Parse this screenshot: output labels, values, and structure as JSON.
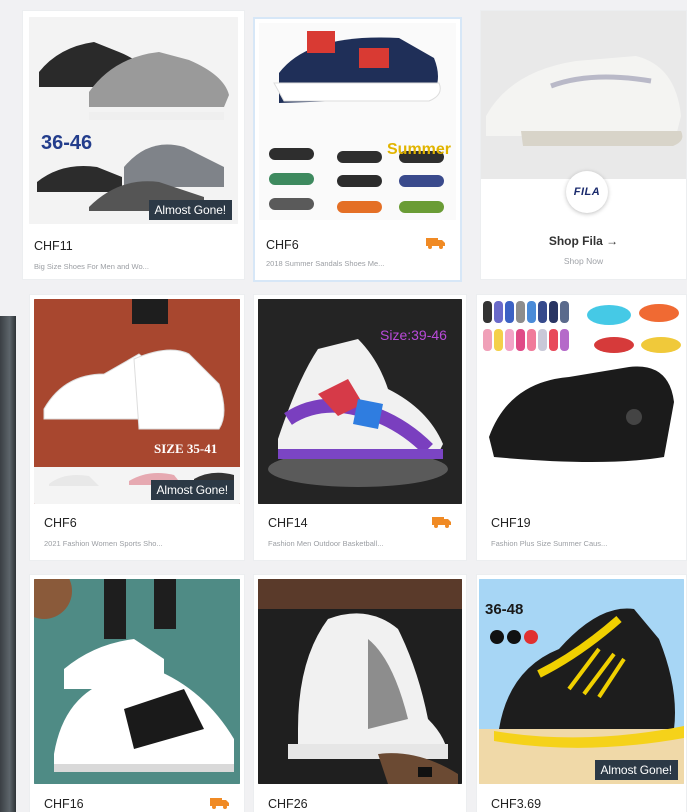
{
  "products": [
    {
      "price": "CHF11",
      "desc": "Big Size Shoes For Men and Wo...",
      "badge": "Almost Gone!",
      "size_tag": "36-46",
      "truck": false
    },
    {
      "price": "CHF6",
      "desc": "2018 Summer Sandals Shoes Me...",
      "badge": "",
      "size_tag": "Summer",
      "truck": true
    },
    {
      "price": "CHF6",
      "desc": "2021 Fashion Women Sports Sho...",
      "badge": "Almost Gone!",
      "size_tag": "SIZE 35-41",
      "truck": false
    },
    {
      "price": "CHF14",
      "desc": "Fashion Men Outdoor Basketball...",
      "badge": "",
      "size_tag": "Size:39-46",
      "truck": true
    },
    {
      "price": "CHF19",
      "desc": "Fashion Plus Size Summer Caus...",
      "badge": "",
      "size_tag": "",
      "truck": false
    },
    {
      "price": "CHF16",
      "desc": "",
      "badge": "",
      "size_tag": "",
      "truck": true
    },
    {
      "price": "CHF26",
      "desc": "",
      "badge": "",
      "size_tag": "",
      "truck": false
    },
    {
      "price": "CHF3.69",
      "desc": "",
      "badge": "Almost Gone!",
      "size_tag": "36-48",
      "truck": false
    }
  ],
  "brand_card": {
    "logo_text": "FILA",
    "title": "Shop Fila →",
    "subtitle": "Shop Now"
  },
  "colors": {
    "truck": "#f08a24",
    "badge_bg": "#2c3946"
  }
}
